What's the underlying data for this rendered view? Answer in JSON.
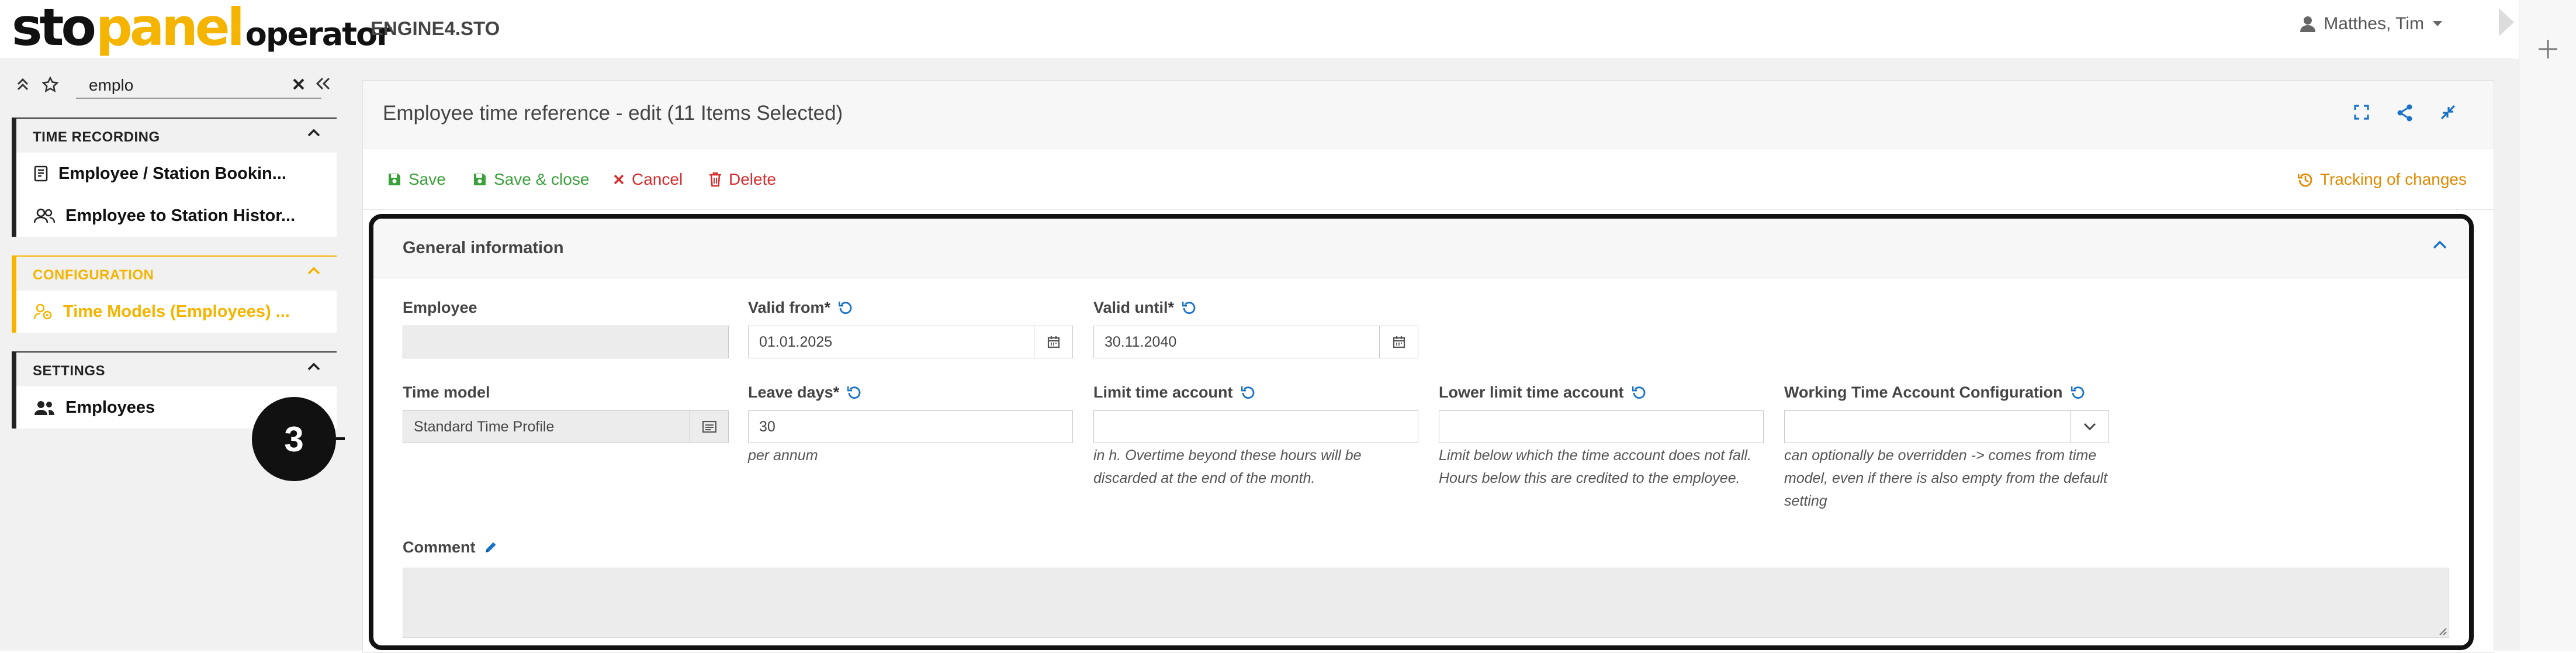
{
  "header": {
    "logo": {
      "sto": "sto",
      "panel": "panel",
      "operator": "operator"
    },
    "app_title": "ENGINE4.STO",
    "user_name": "Matthes, Tim"
  },
  "sidebar": {
    "search_value": "emplo",
    "sections": [
      {
        "title": "TIME RECORDING",
        "items": [
          "Employee / Station Bookin...",
          "Employee to Station Histor..."
        ]
      },
      {
        "title": "CONFIGURATION",
        "items": [
          "Time Models (Employees) ..."
        ]
      },
      {
        "title": "SETTINGS",
        "items": [
          "Employees"
        ]
      }
    ]
  },
  "callout": {
    "number": "3"
  },
  "panel": {
    "title": "Employee time reference - edit (11 Items Selected)",
    "toolbar": {
      "save": "Save",
      "save_close": "Save & close",
      "cancel": "Cancel",
      "delete": "Delete",
      "tracking": "Tracking of changes"
    },
    "form": {
      "section_title": "General information",
      "employee": {
        "label": "Employee",
        "value": ""
      },
      "valid_from": {
        "label": "Valid from",
        "required": "*",
        "value": "01.01.2025"
      },
      "valid_until": {
        "label": "Valid until",
        "required": "*",
        "value": "30.11.2040"
      },
      "time_model": {
        "label": "Time model",
        "value": "Standard Time Profile"
      },
      "leave_days": {
        "label": "Leave days",
        "required": "*",
        "value": "30",
        "hint": "per annum"
      },
      "limit_time_account": {
        "label": "Limit time account",
        "value": "",
        "hint": "in h. Overtime beyond these hours will be discarded at the end of the month."
      },
      "lower_limit_time_account": {
        "label": "Lower limit time account",
        "value": "",
        "hint": "Limit below which the time account does not fall. Hours below this are credited to the employee."
      },
      "working_time_account_config": {
        "label": "Working Time Account Configuration",
        "value": "",
        "hint": "can optionally be overridden -> comes from time model, even if there is also empty from the default setting"
      },
      "comment": {
        "label": "Comment",
        "value": ""
      }
    }
  },
  "colors": {
    "accent": "#f5b400",
    "save_green": "#3aa03a",
    "danger_red": "#d32f2f",
    "tracking_orange": "#e08a00",
    "link_blue": "#1a73c8"
  },
  "icons": [
    "double-chevron-up-icon",
    "star-pin-icon",
    "close-icon",
    "double-chevron-left-icon",
    "chevron-up-icon",
    "book-icon",
    "users-icon",
    "user-settings-icon",
    "user-icon",
    "caret-down-icon",
    "plus-icon",
    "expand-icon",
    "share-icon",
    "collapse-icon",
    "floppy-icon",
    "x-icon",
    "trash-icon",
    "history-icon",
    "reset-icon",
    "calendar-icon",
    "list-icon",
    "chevron-down-icon",
    "pencil-icon",
    "resize-grip-icon"
  ]
}
